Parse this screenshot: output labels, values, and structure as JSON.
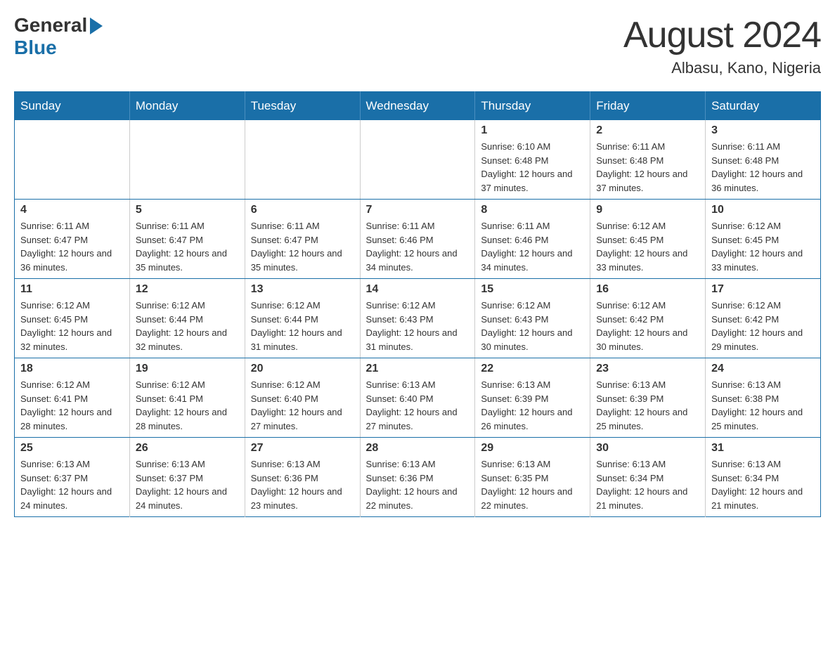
{
  "header": {
    "logo_general": "General",
    "logo_blue": "Blue",
    "month_title": "August 2024",
    "location": "Albasu, Kano, Nigeria"
  },
  "days_of_week": [
    "Sunday",
    "Monday",
    "Tuesday",
    "Wednesday",
    "Thursday",
    "Friday",
    "Saturday"
  ],
  "weeks": [
    [
      {
        "day": "",
        "info": ""
      },
      {
        "day": "",
        "info": ""
      },
      {
        "day": "",
        "info": ""
      },
      {
        "day": "",
        "info": ""
      },
      {
        "day": "1",
        "info": "Sunrise: 6:10 AM\nSunset: 6:48 PM\nDaylight: 12 hours and 37 minutes."
      },
      {
        "day": "2",
        "info": "Sunrise: 6:11 AM\nSunset: 6:48 PM\nDaylight: 12 hours and 37 minutes."
      },
      {
        "day": "3",
        "info": "Sunrise: 6:11 AM\nSunset: 6:48 PM\nDaylight: 12 hours and 36 minutes."
      }
    ],
    [
      {
        "day": "4",
        "info": "Sunrise: 6:11 AM\nSunset: 6:47 PM\nDaylight: 12 hours and 36 minutes."
      },
      {
        "day": "5",
        "info": "Sunrise: 6:11 AM\nSunset: 6:47 PM\nDaylight: 12 hours and 35 minutes."
      },
      {
        "day": "6",
        "info": "Sunrise: 6:11 AM\nSunset: 6:47 PM\nDaylight: 12 hours and 35 minutes."
      },
      {
        "day": "7",
        "info": "Sunrise: 6:11 AM\nSunset: 6:46 PM\nDaylight: 12 hours and 34 minutes."
      },
      {
        "day": "8",
        "info": "Sunrise: 6:11 AM\nSunset: 6:46 PM\nDaylight: 12 hours and 34 minutes."
      },
      {
        "day": "9",
        "info": "Sunrise: 6:12 AM\nSunset: 6:45 PM\nDaylight: 12 hours and 33 minutes."
      },
      {
        "day": "10",
        "info": "Sunrise: 6:12 AM\nSunset: 6:45 PM\nDaylight: 12 hours and 33 minutes."
      }
    ],
    [
      {
        "day": "11",
        "info": "Sunrise: 6:12 AM\nSunset: 6:45 PM\nDaylight: 12 hours and 32 minutes."
      },
      {
        "day": "12",
        "info": "Sunrise: 6:12 AM\nSunset: 6:44 PM\nDaylight: 12 hours and 32 minutes."
      },
      {
        "day": "13",
        "info": "Sunrise: 6:12 AM\nSunset: 6:44 PM\nDaylight: 12 hours and 31 minutes."
      },
      {
        "day": "14",
        "info": "Sunrise: 6:12 AM\nSunset: 6:43 PM\nDaylight: 12 hours and 31 minutes."
      },
      {
        "day": "15",
        "info": "Sunrise: 6:12 AM\nSunset: 6:43 PM\nDaylight: 12 hours and 30 minutes."
      },
      {
        "day": "16",
        "info": "Sunrise: 6:12 AM\nSunset: 6:42 PM\nDaylight: 12 hours and 30 minutes."
      },
      {
        "day": "17",
        "info": "Sunrise: 6:12 AM\nSunset: 6:42 PM\nDaylight: 12 hours and 29 minutes."
      }
    ],
    [
      {
        "day": "18",
        "info": "Sunrise: 6:12 AM\nSunset: 6:41 PM\nDaylight: 12 hours and 28 minutes."
      },
      {
        "day": "19",
        "info": "Sunrise: 6:12 AM\nSunset: 6:41 PM\nDaylight: 12 hours and 28 minutes."
      },
      {
        "day": "20",
        "info": "Sunrise: 6:12 AM\nSunset: 6:40 PM\nDaylight: 12 hours and 27 minutes."
      },
      {
        "day": "21",
        "info": "Sunrise: 6:13 AM\nSunset: 6:40 PM\nDaylight: 12 hours and 27 minutes."
      },
      {
        "day": "22",
        "info": "Sunrise: 6:13 AM\nSunset: 6:39 PM\nDaylight: 12 hours and 26 minutes."
      },
      {
        "day": "23",
        "info": "Sunrise: 6:13 AM\nSunset: 6:39 PM\nDaylight: 12 hours and 25 minutes."
      },
      {
        "day": "24",
        "info": "Sunrise: 6:13 AM\nSunset: 6:38 PM\nDaylight: 12 hours and 25 minutes."
      }
    ],
    [
      {
        "day": "25",
        "info": "Sunrise: 6:13 AM\nSunset: 6:37 PM\nDaylight: 12 hours and 24 minutes."
      },
      {
        "day": "26",
        "info": "Sunrise: 6:13 AM\nSunset: 6:37 PM\nDaylight: 12 hours and 24 minutes."
      },
      {
        "day": "27",
        "info": "Sunrise: 6:13 AM\nSunset: 6:36 PM\nDaylight: 12 hours and 23 minutes."
      },
      {
        "day": "28",
        "info": "Sunrise: 6:13 AM\nSunset: 6:36 PM\nDaylight: 12 hours and 22 minutes."
      },
      {
        "day": "29",
        "info": "Sunrise: 6:13 AM\nSunset: 6:35 PM\nDaylight: 12 hours and 22 minutes."
      },
      {
        "day": "30",
        "info": "Sunrise: 6:13 AM\nSunset: 6:34 PM\nDaylight: 12 hours and 21 minutes."
      },
      {
        "day": "31",
        "info": "Sunrise: 6:13 AM\nSunset: 6:34 PM\nDaylight: 12 hours and 21 minutes."
      }
    ]
  ]
}
